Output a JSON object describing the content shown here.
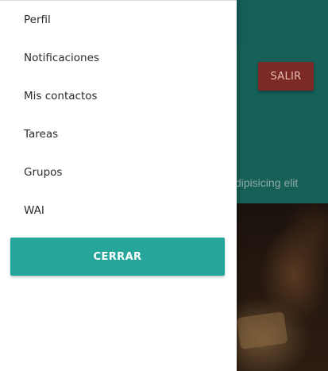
{
  "drawer": {
    "items": [
      {
        "label": "Perfil"
      },
      {
        "label": "Notificaciones"
      },
      {
        "label": "Mis contactos"
      },
      {
        "label": "Tareas"
      },
      {
        "label": "Grupos"
      },
      {
        "label": "WAI"
      }
    ],
    "close_label": "CERRAR"
  },
  "background": {
    "logout_label": "SALIR",
    "body_text_visible": "dipisicing elit."
  },
  "colors": {
    "accent": "#26a69a",
    "header": "#176058",
    "logout": "#7c2a26"
  }
}
